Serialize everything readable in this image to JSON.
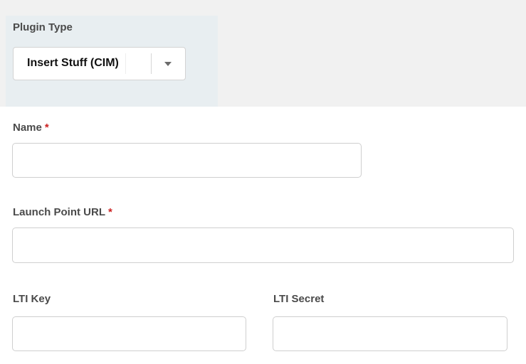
{
  "plugin_type": {
    "label": "Plugin Type",
    "selected_value": "Insert Stuff (CIM)",
    "caret_icon": "chevron-down-icon"
  },
  "form": {
    "name": {
      "label": "Name",
      "required_marker": "*",
      "value": "",
      "placeholder": ""
    },
    "launch_point_url": {
      "label": "Launch Point URL",
      "required_marker": "*",
      "value": "",
      "placeholder": ""
    },
    "lti_key": {
      "label": "LTI Key",
      "value": "",
      "placeholder": ""
    },
    "lti_secret": {
      "label": "LTI Secret",
      "value": "",
      "placeholder": ""
    }
  },
  "colors": {
    "required": "#cc2222",
    "panel_background": "#e8eef1",
    "band_background": "#f1f1f1"
  }
}
